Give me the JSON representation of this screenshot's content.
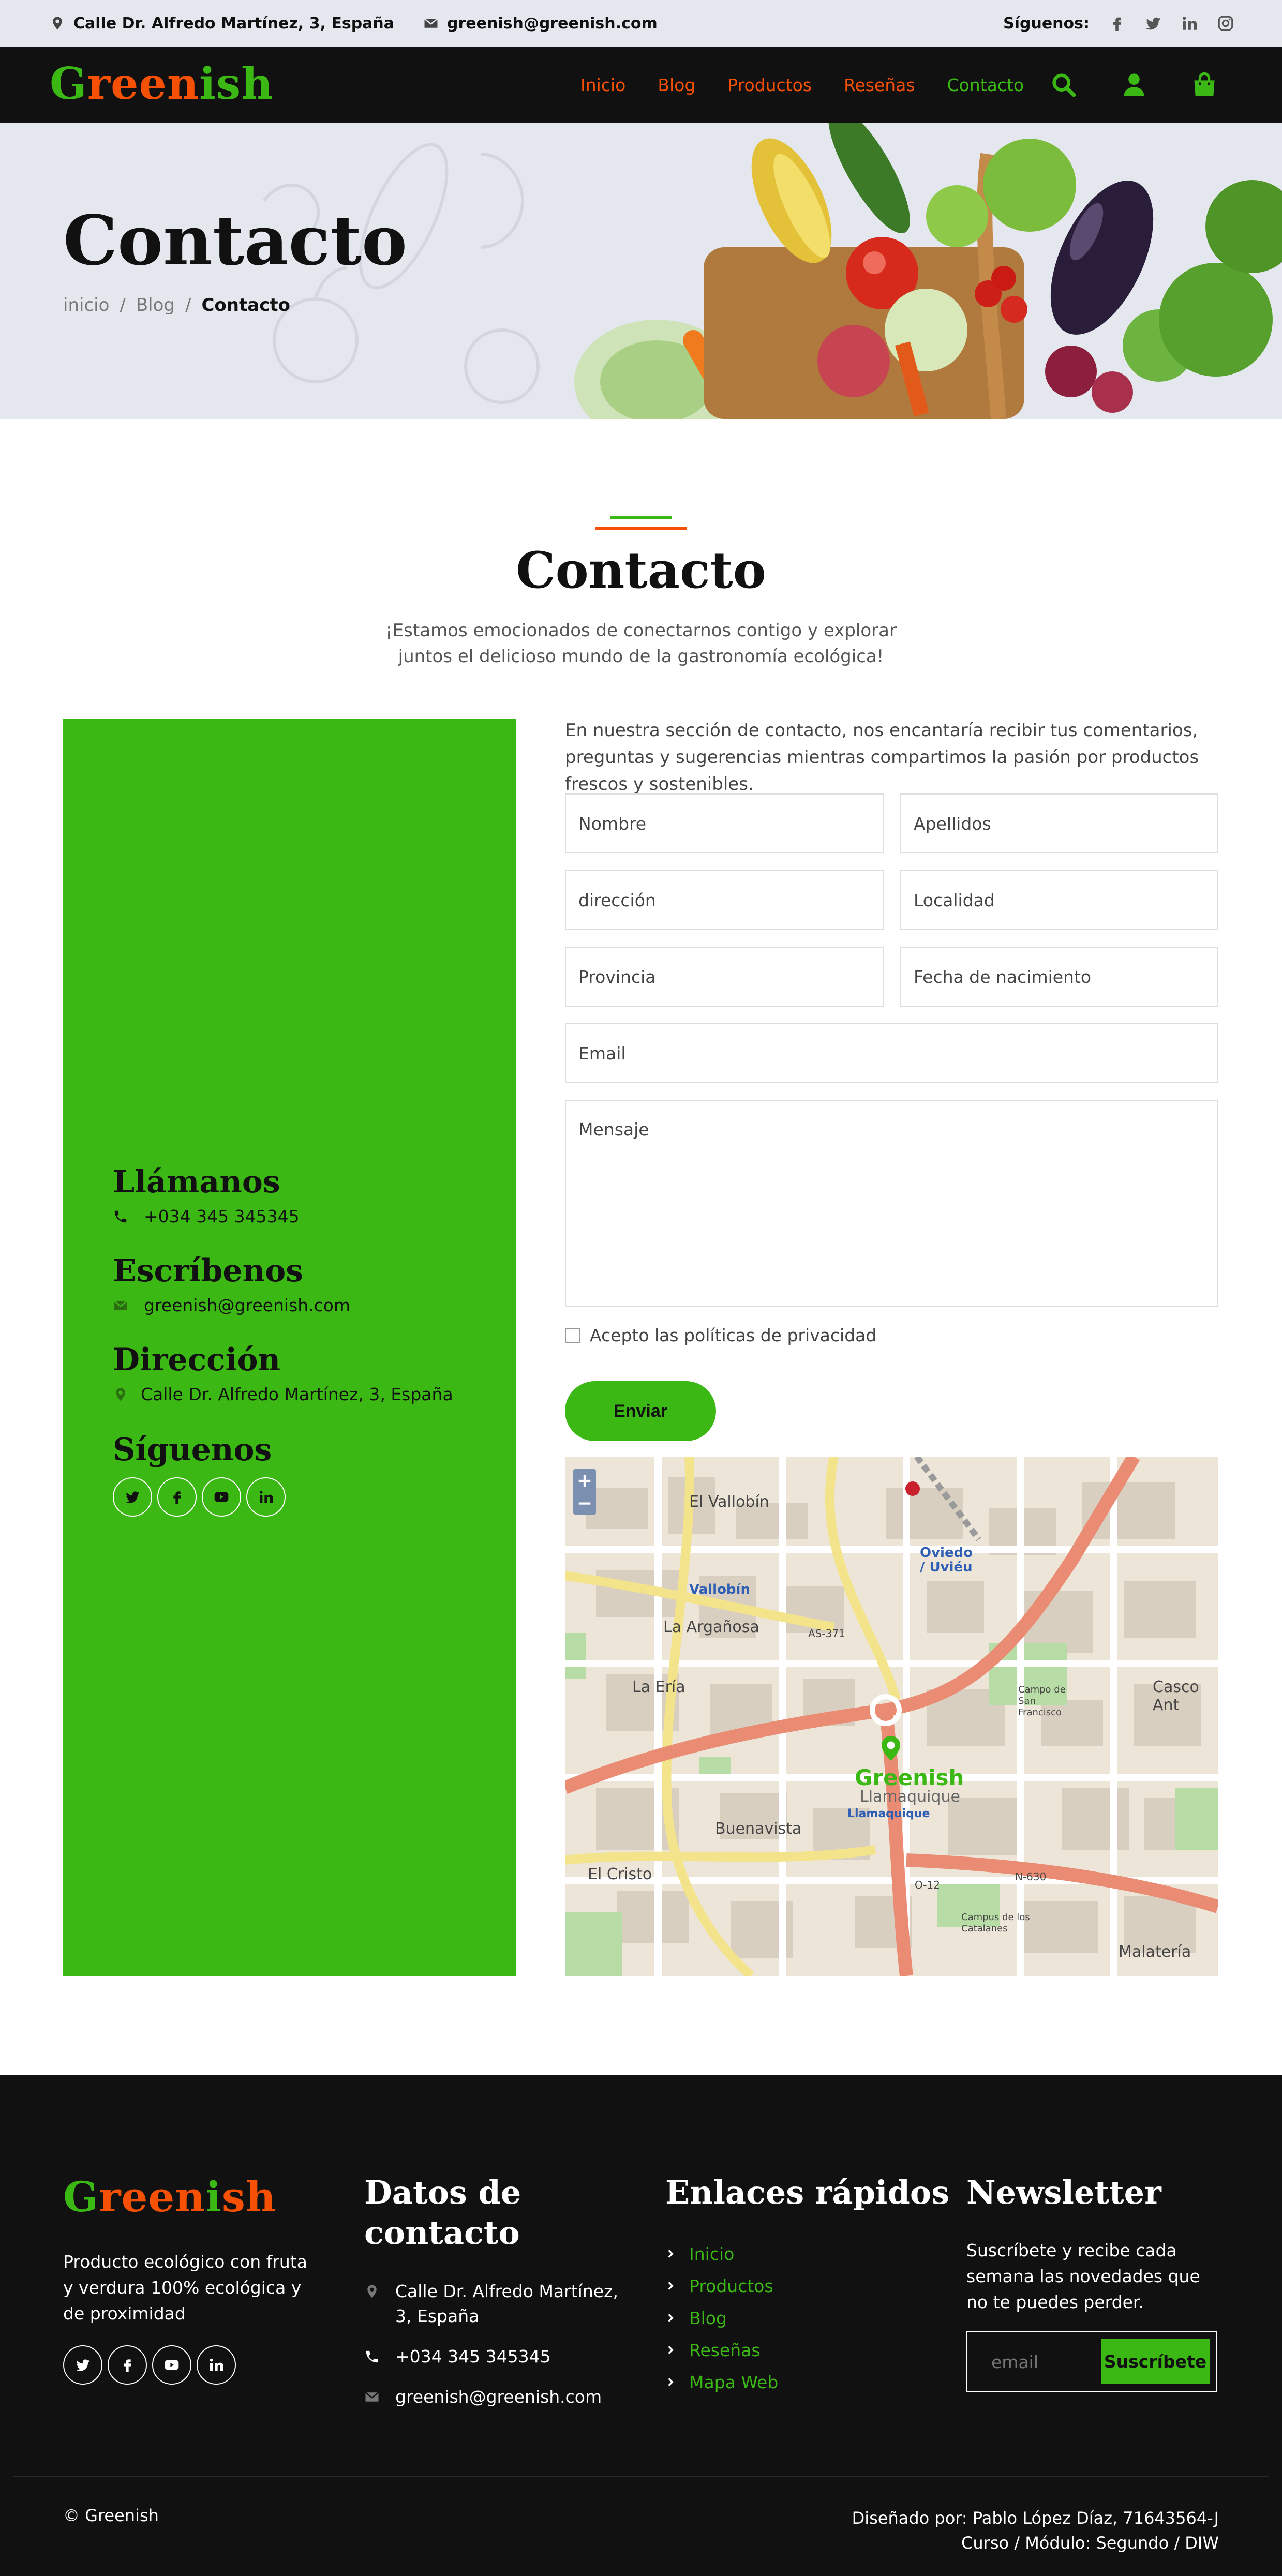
{
  "topbar": {
    "address": "Calle Dr. Alfredo Martínez, 3, España",
    "email": "greenish@greenish.com",
    "follow_label": "Síguenos:",
    "social_icons": [
      "facebook-icon",
      "twitter-icon",
      "linkedin-icon",
      "instagram-icon"
    ]
  },
  "brand": {
    "part1": "G",
    "part2": "reen",
    "part3": "i",
    "part4": "sh",
    "green": "#3cb815",
    "orange": "#f65005"
  },
  "nav": {
    "items": [
      {
        "label": "Inicio"
      },
      {
        "label": "Blog"
      },
      {
        "label": "Productos"
      },
      {
        "label": "Reseñas"
      },
      {
        "label": "Contacto"
      }
    ],
    "icons": [
      "search-icon",
      "user-icon",
      "shopping-bag-icon"
    ]
  },
  "hero": {
    "title": "Contacto",
    "breadcrumb": [
      "inicio",
      "/",
      "Blog",
      "/",
      "Contacto"
    ]
  },
  "section": {
    "title": "Contacto",
    "subtitle": "¡Estamos emocionados de conectarnos contigo y explorar juntos el delicioso mundo de la gastronomía ecológica!"
  },
  "info": {
    "call_title": "Llámanos",
    "phone": "+034 345 345345",
    "write_title": "Escríbenos",
    "email": "greenish@greenish.com",
    "address_title": "Dirección",
    "address": "Calle Dr. Alfredo Martínez, 3, España",
    "follow_title": "Síguenos"
  },
  "form": {
    "intro": "En nuestra sección de contacto, nos encantaría recibir tus comentarios, preguntas y sugerencias mientras compartimos la pasión por productos frescos y sostenibles.",
    "nombre": "Nombre",
    "apellidos": "Apellidos",
    "direccion": "dirección",
    "localidad": "Localidad",
    "provincia": "Provincia",
    "nacimiento": "Fecha de nacimiento",
    "email": "Email",
    "mensaje": "Mensaje",
    "privacy": "Acepto las políticas de privacidad",
    "submit": "Enviar"
  },
  "map": {
    "zoom_in": "+",
    "zoom_out": "−",
    "labels": {
      "vallobin_hill": "El Vallobín",
      "oviedo": "Oviedo / Uviéu",
      "vallobin": "Vallobín",
      "arganosa": "La Argañosa",
      "as371": "AS-371",
      "erias": "La Ería",
      "llamaquique": "Llamaquique",
      "llamaquique_b": "Llamaquique",
      "buenavista": "Buenavista",
      "cristo": "El Cristo",
      "o12": "O-12",
      "n630": "N-630",
      "campo": "Campo de San Francisco",
      "casco": "Casco Ant",
      "malateria": "Malatería",
      "campus": "Campus de los Catalanes",
      "marker": "Greenish"
    }
  },
  "footer": {
    "desc": "Producto ecológico con fruta y verdura 100% ecológica y de proximidad",
    "contact_title": "Datos de contacto",
    "address": "Calle Dr. Alfredo Martínez, 3, España",
    "phone": "+034 345 345345",
    "email": "greenish@greenish.com",
    "links_title": "Enlaces rápidos",
    "links": [
      {
        "label": "Inicio"
      },
      {
        "label": "Productos"
      },
      {
        "label": "Blog"
      },
      {
        "label": "Reseñas"
      },
      {
        "label": "Mapa Web"
      }
    ],
    "newsletter_title": "Newsletter",
    "newsletter_desc": "Suscríbete y recibe cada semana las novedades que no te puedes perder.",
    "newsletter_placeholder": "email",
    "newsletter_button": "Suscríbete",
    "copyright": "© Greenish",
    "credit_line1": "Diseñado por: Pablo López Díaz, 71643564-J",
    "credit_line2": "Curso / Módulo: Segundo / DIW"
  }
}
